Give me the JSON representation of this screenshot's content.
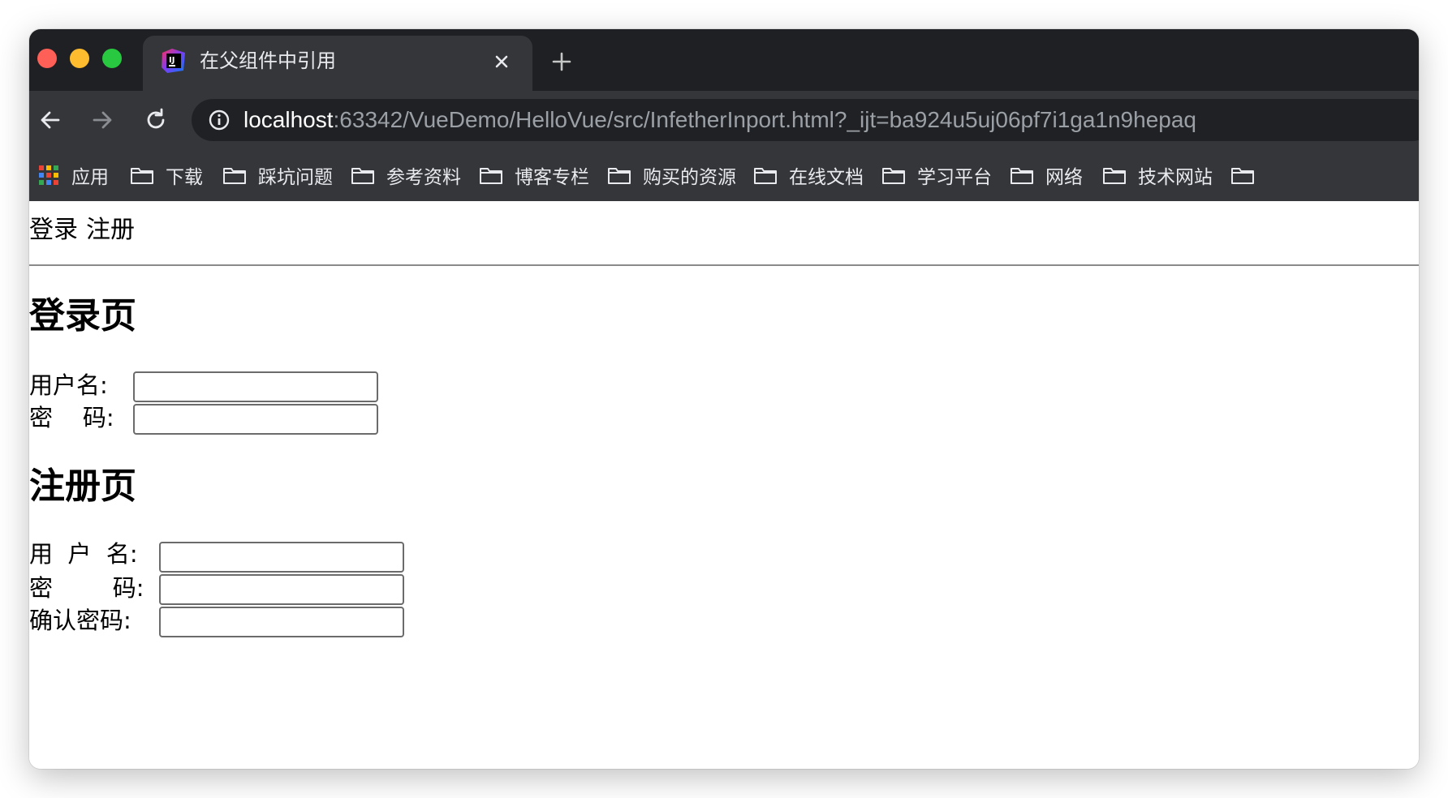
{
  "browser": {
    "tab_title": "在父组件中引用",
    "url_host": "localhost",
    "url_path": ":63342/VueDemo/HelloVue/src/InfetherInport.html?_ijt=ba924u5uj06pf7i1ga1n9hepaq"
  },
  "bookmarks": {
    "apps": "应用",
    "items": [
      "下载",
      "踩坑问题",
      "参考资料",
      "博客专栏",
      "购买的资源",
      "在线文档",
      "学习平台",
      "网络",
      "技术网站"
    ]
  },
  "nav": {
    "login_link": "登录",
    "register_link": "注册"
  },
  "login": {
    "heading": "登录页",
    "username_label": "用户名:",
    "username_value": "",
    "password_label": "密    码:",
    "password_value": ""
  },
  "register": {
    "heading": "注册页",
    "username_label": "用  户  名:",
    "username_value": "",
    "password_label": "密        码:",
    "password_value": "",
    "confirm_label": "确认密码:",
    "confirm_value": ""
  }
}
